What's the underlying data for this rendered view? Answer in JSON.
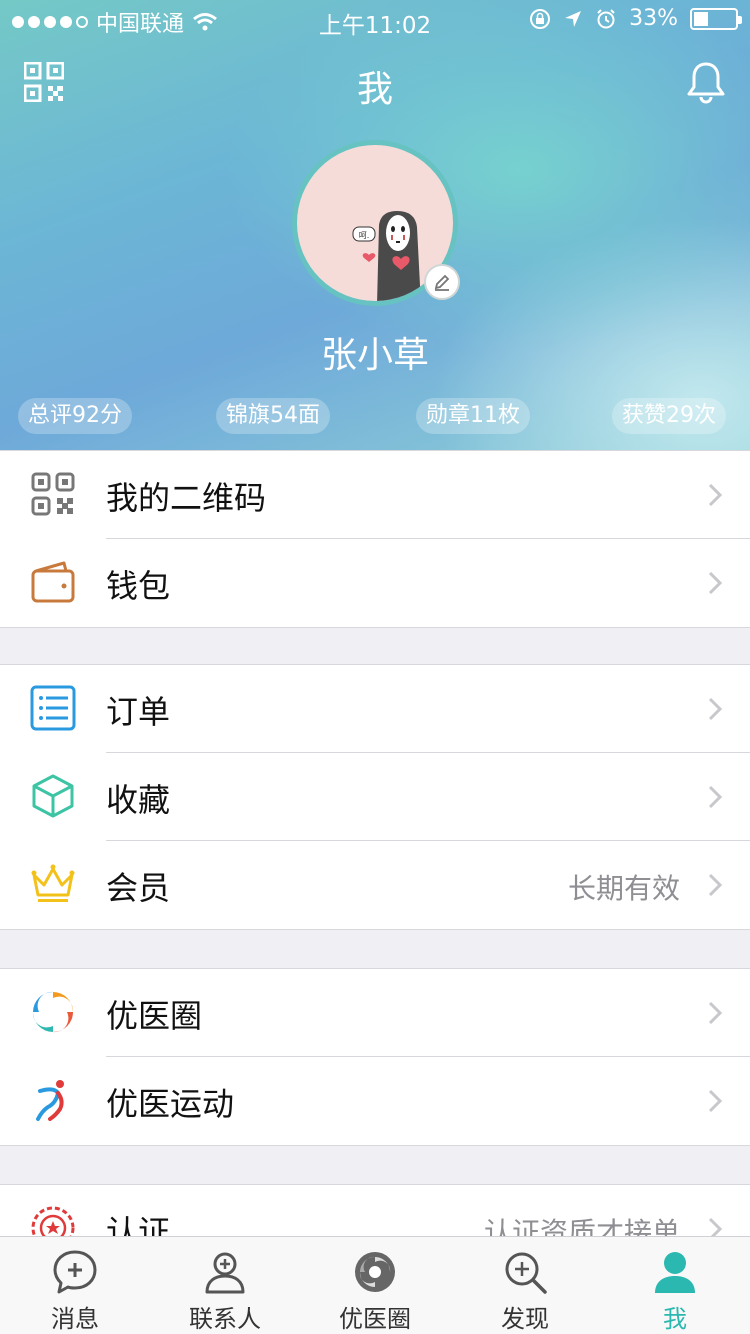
{
  "status_bar": {
    "carrier": "中国联通",
    "time": "上午11:02",
    "battery": "33%",
    "battery_level": 0.33
  },
  "header": {
    "title": "我",
    "username": "张小草",
    "avatar_text": "呵.",
    "stats": [
      "总评92分",
      "锦旗54面",
      "勋章11枚",
      "获赞29次"
    ]
  },
  "menu": {
    "group1": [
      {
        "label": "我的二维码",
        "icon": "qr-code-icon"
      },
      {
        "label": "钱包",
        "icon": "wallet-icon"
      }
    ],
    "group2": [
      {
        "label": "订单",
        "icon": "list-icon"
      },
      {
        "label": "收藏",
        "icon": "cube-icon"
      },
      {
        "label": "会员",
        "icon": "crown-icon",
        "value": "长期有效"
      }
    ],
    "group3": [
      {
        "label": "优医圈",
        "icon": "swirl-icon"
      },
      {
        "label": "优医运动",
        "icon": "runner-icon"
      }
    ],
    "group4": [
      {
        "label": "认证",
        "icon": "badge-icon",
        "value": "认证资质才接单"
      }
    ]
  },
  "tabbar": [
    {
      "label": "消息",
      "icon": "chat-icon"
    },
    {
      "label": "联系人",
      "icon": "contact-icon"
    },
    {
      "label": "优医圈",
      "icon": "swirl-icon"
    },
    {
      "label": "发现",
      "icon": "search-icon"
    },
    {
      "label": "我",
      "icon": "person-icon",
      "active": true
    }
  ],
  "colors": {
    "accent": "#2bb8b0",
    "wallet": "#c87a3c",
    "list": "#2a9ae0",
    "cube": "#3cc4a4",
    "crown": "#f2c21a",
    "badge": "#e03a3a"
  }
}
